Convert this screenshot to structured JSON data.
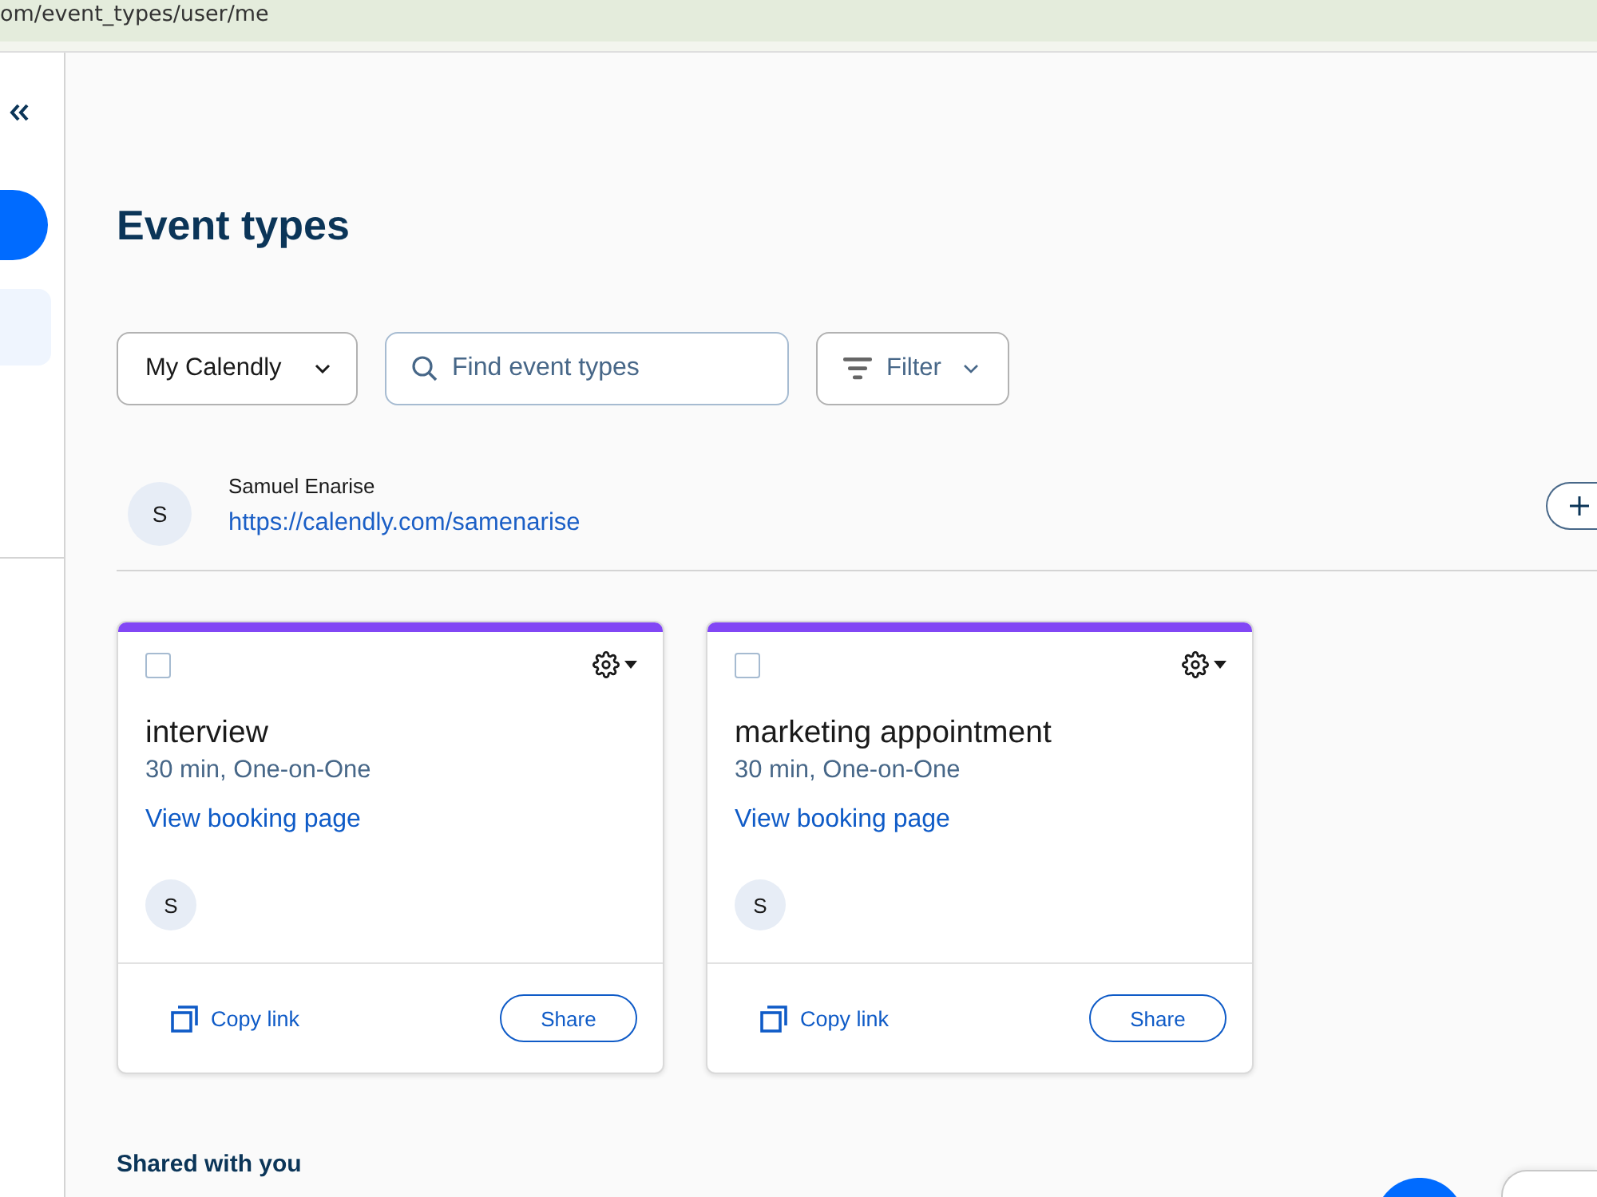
{
  "url_bar": {
    "value": "om/event_types/user/me"
  },
  "sidebar": {
    "items": [
      {
        "selected": true
      }
    ]
  },
  "page": {
    "title": "Event types"
  },
  "toolbar": {
    "dropdown": {
      "label": "My Calendly"
    },
    "search": {
      "placeholder": "Find event types"
    },
    "filter": {
      "label": "Filter"
    }
  },
  "user": {
    "initial": "S",
    "name": "Samuel Enarise",
    "link": "https://calendly.com/samenarise"
  },
  "event_cards": [
    {
      "title": "interview",
      "details": "30 min, One-on-One",
      "link": "View booking page",
      "host_initial": "S",
      "checked": false,
      "color": "#8247f5",
      "copy_link": "Copy link",
      "share": "Share"
    },
    {
      "title": "marketing appointment",
      "details": "30 min, One-on-One",
      "link": "View booking page",
      "host_initial": "S",
      "checked": false,
      "color": "#8247f5",
      "copy_link": "Copy link",
      "share": "Share"
    }
  ],
  "shared_section": {
    "title": "Shared with you"
  }
}
